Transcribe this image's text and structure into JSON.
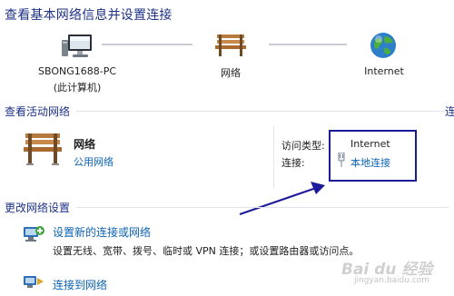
{
  "page_title": "查看基本网络信息并设置连接",
  "network_map": {
    "computer_name": "SBONG1688-PC",
    "computer_sub": "(此计算机)",
    "network_label": "网络",
    "internet_label": "Internet"
  },
  "active_networks": {
    "section_title": "查看活动网络",
    "edge_char": "连",
    "network_name": "网络",
    "network_type": "公用网络",
    "access_type_label": "访问类型:",
    "access_type_value": "Internet",
    "connection_label": "连接:",
    "connection_value": "本地连接"
  },
  "change_settings": {
    "section_title": "更改网络设置",
    "items": [
      {
        "label": "设置新的连接或网络",
        "description": "设置无线、宽带、拨号、临时或 VPN 连接；或设置路由器或访问点。"
      },
      {
        "label": "连接到网络",
        "description": ""
      }
    ]
  },
  "watermark": "Bai du 经验",
  "watermark_url": "jingyan.baidu.com",
  "colors": {
    "title_blue": "#1e3287",
    "link_blue": "#0b63b6",
    "highlight_box": "#1a1a9a",
    "arrow": "#1a1a9a"
  },
  "icons": [
    "computer-icon",
    "bench-icon",
    "globe-icon",
    "network-bench-icon",
    "plug-icon",
    "network-setup-icon",
    "connect-network-icon"
  ]
}
